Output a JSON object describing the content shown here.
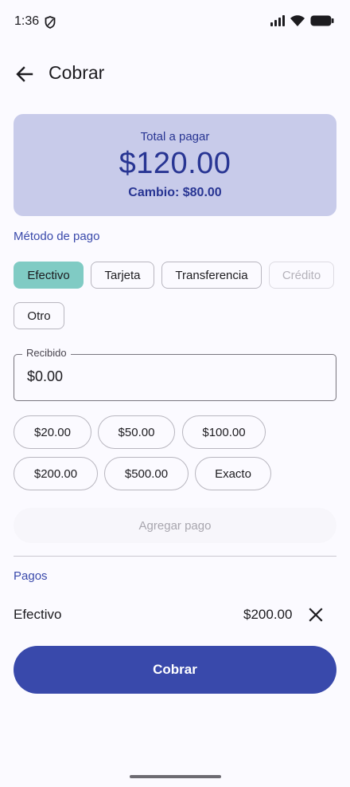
{
  "status_bar": {
    "time": "1:36",
    "icons": [
      "shield-icon",
      "signal-icon",
      "wifi-icon",
      "battery-icon"
    ]
  },
  "app_bar": {
    "back_icon": "arrow-back-icon",
    "title": "Cobrar"
  },
  "summary": {
    "total_label": "Total a pagar",
    "total_amount": "$120.00",
    "change_text": "Cambio: $80.00"
  },
  "payment_method": {
    "label": "Método de pago",
    "options": [
      {
        "label": "Efectivo",
        "state": "selected"
      },
      {
        "label": "Tarjeta",
        "state": "normal"
      },
      {
        "label": "Transferencia",
        "state": "normal"
      },
      {
        "label": "Crédito",
        "state": "disabled"
      },
      {
        "label": "Otro",
        "state": "normal"
      }
    ]
  },
  "received": {
    "label": "Recibido",
    "value": "$0.00"
  },
  "quick_amounts": [
    "$20.00",
    "$50.00",
    "$100.00",
    "$200.00",
    "$500.00",
    "Exacto"
  ],
  "add_payment_label": "Agregar pago",
  "payments": {
    "label": "Pagos",
    "items": [
      {
        "method": "Efectivo",
        "amount": "$200.00",
        "remove_icon": "close-icon"
      }
    ]
  },
  "charge_button_label": "Cobrar",
  "colors": {
    "primary": "#3949ab",
    "card_bg": "#c8cbea",
    "selected_chip": "#80cbc4",
    "background": "#fbfaff"
  }
}
